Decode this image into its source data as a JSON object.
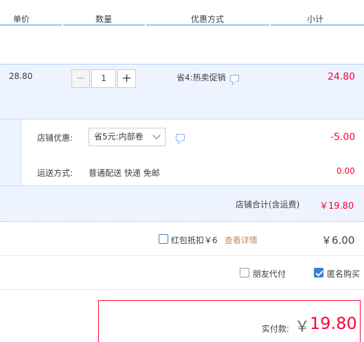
{
  "header": {
    "col_price": "单价",
    "col_qty": "数量",
    "col_promo": "优惠方式",
    "col_subtotal": "小计"
  },
  "item": {
    "price": "28.80",
    "qty_minus": "−",
    "qty_value": "1",
    "qty_plus": "+",
    "promo": "省4:热卖促销",
    "subtotal": "24.80"
  },
  "shop": {
    "discount_label": "店铺优惠:",
    "discount_select": "省5元:内部卷",
    "discount_value": "-5.00",
    "shipping_label": "运送方式:",
    "shipping_method": "普通配送 快递 免邮",
    "shipping_value": "0.00",
    "total_label": "店铺合计(含运费)",
    "total_value": "￥19.80"
  },
  "hongbao": {
    "label": "红包抵扣￥6",
    "detail_link": "查看详情",
    "amount": "￥6.00"
  },
  "options": {
    "friend_pay": "朋友代付",
    "anonymous": "匿名购买",
    "friend_pay_checked": false,
    "anonymous_checked": true
  },
  "payment": {
    "label": "实付款:",
    "currency": "￥",
    "amount": "19.80"
  },
  "colors": {
    "accent_red": "#ff0036",
    "accent_blue": "#3e7bd4",
    "row_bg": "#eef4ff",
    "link": "#c8895c"
  }
}
